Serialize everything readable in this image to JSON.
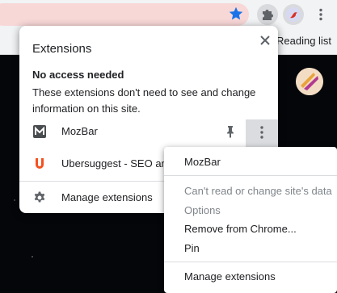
{
  "browser": {
    "bookmarks_bar": {
      "reading_list": "Reading list"
    }
  },
  "extensions_panel": {
    "title": "Extensions",
    "section_title": "No access needed",
    "section_desc": "These extensions don't need to see and change information on this site.",
    "extensions": [
      {
        "name": "MozBar",
        "icon": "mozbar-icon"
      },
      {
        "name": "Ubersuggest - SEO and",
        "icon": "ubersuggest-icon"
      }
    ],
    "manage_label": "Manage extensions"
  },
  "context_menu": {
    "items": [
      {
        "label": "MozBar",
        "enabled": true
      },
      {
        "label": "Can't read or change site's data",
        "enabled": false
      },
      {
        "label": "Options",
        "enabled": false
      },
      {
        "label": "Remove from Chrome...",
        "enabled": true
      },
      {
        "label": "Pin",
        "enabled": true
      },
      {
        "label": "Manage extensions",
        "enabled": true
      }
    ]
  },
  "colors": {
    "accent": "#1a73e8",
    "ubersuggest": "#f4511e",
    "menu_disabled": "#80868b",
    "omnibox": "#f8d7d7"
  }
}
